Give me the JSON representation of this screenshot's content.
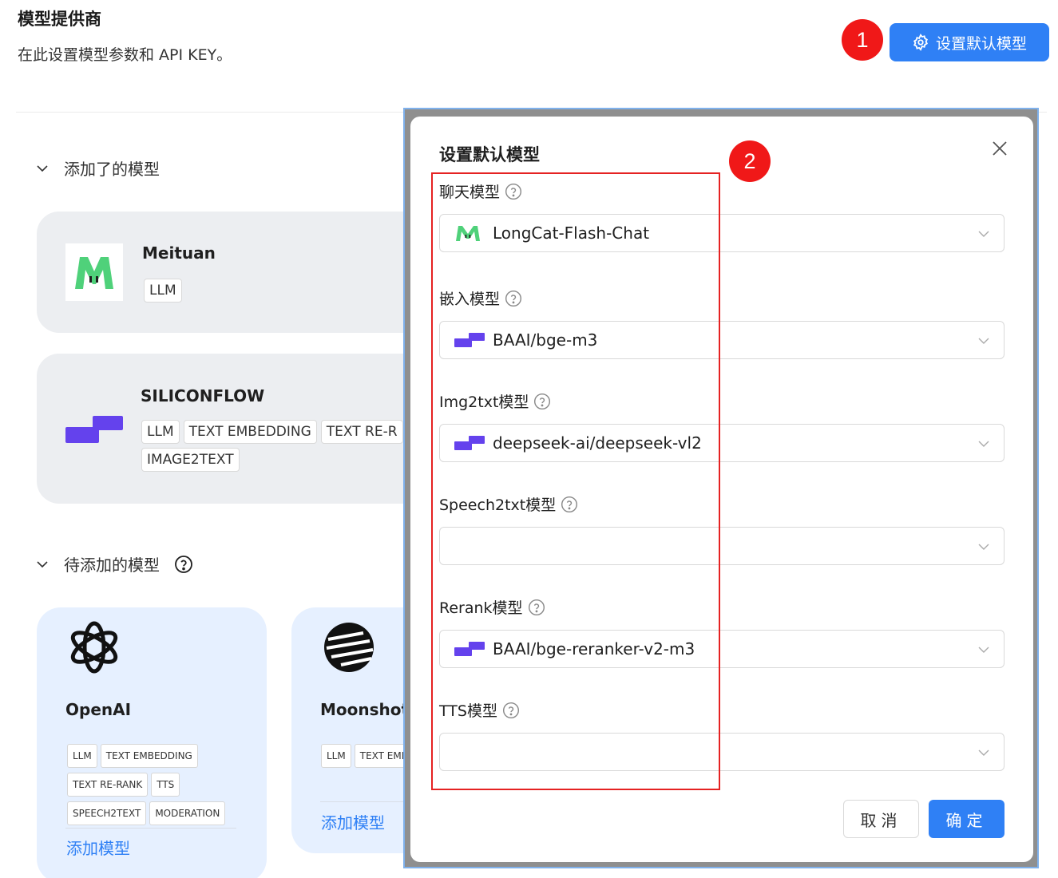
{
  "header": {
    "title": "模型提供商",
    "description": "在此设置模型参数和 API KEY。",
    "default_model_button": "设置默认模型"
  },
  "annotations": {
    "badge_1": "1",
    "badge_2": "2"
  },
  "sections": {
    "added": "添加了的模型",
    "pending": "待添加的模型"
  },
  "added_models": [
    {
      "name": "Meituan",
      "tags": [
        "LLM"
      ]
    },
    {
      "name": "SILICONFLOW",
      "tags": [
        "LLM",
        "TEXT EMBEDDING",
        "TEXT RE-R",
        "IMAGE2TEXT"
      ]
    }
  ],
  "pending_models": [
    {
      "name": "OpenAI",
      "tags": [
        "LLM",
        "TEXT EMBEDDING",
        "TEXT RE-RANK",
        "TTS",
        "SPEECH2TEXT",
        "MODERATION"
      ],
      "add_label": "添加模型"
    },
    {
      "name": "Moonshot",
      "tags": [
        "LLM",
        "TEXT EMI"
      ],
      "add_label": "添加模型"
    }
  ],
  "modal": {
    "title": "设置默认模型",
    "fields": [
      {
        "label": "聊天模型",
        "value": "LongCat-Flash-Chat",
        "icon": "meituan-icon"
      },
      {
        "label": "嵌入模型",
        "value": "BAAI/bge-m3",
        "icon": "siliconflow-icon"
      },
      {
        "label": "Img2txt模型",
        "value": "deepseek-ai/deepseek-vl2",
        "icon": "siliconflow-icon"
      },
      {
        "label": "Speech2txt模型",
        "value": "",
        "icon": ""
      },
      {
        "label": "Rerank模型",
        "value": "BAAI/bge-reranker-v2-m3",
        "icon": "siliconflow-icon"
      },
      {
        "label": "TTS模型",
        "value": "",
        "icon": ""
      }
    ],
    "cancel": "取消",
    "ok": "确定"
  },
  "colors": {
    "primary": "#2f80f5",
    "annotation_red": "#f01818",
    "siliconflow": "#6442ed",
    "meituan_green": "#4fd17a"
  }
}
